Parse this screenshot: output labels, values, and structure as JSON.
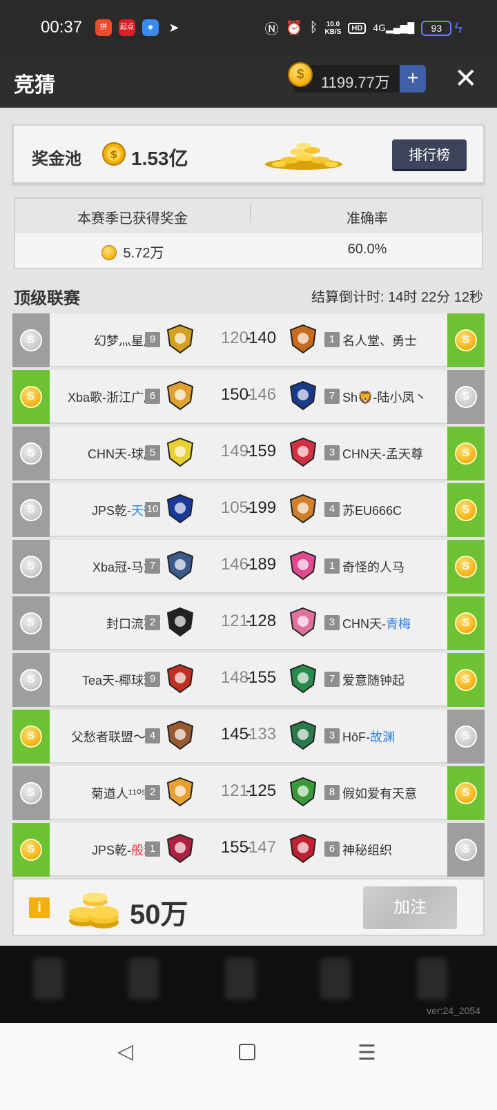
{
  "status_bar": {
    "time": "00:37",
    "apps": [
      "拼多多",
      "起点",
      "app",
      "plane"
    ],
    "net_speed": "10.0",
    "net_unit": "KB/S",
    "hd": "HD",
    "signal": "4G",
    "battery": "93"
  },
  "header": {
    "title": "竞猜",
    "balance": "1199.77万",
    "plus_label": "+",
    "close_label": "✕"
  },
  "pool": {
    "label": "奖金池",
    "amount": "1.53亿",
    "rank_button": "排行榜"
  },
  "stats": {
    "earned_label": "本赛季已获得奖金",
    "earned_value": "5.72万",
    "accuracy_label": "准确率",
    "accuracy_value": "60.0%"
  },
  "league": {
    "title": "顶级联赛",
    "countdown": "结算倒计时:  14时 22分 12秒"
  },
  "matches": [
    {
      "left_prefix": "幻梦灬星辰",
      "left_suffix": "",
      "left_color": "",
      "left_level": "9",
      "left_score": "120",
      "right_score": "140",
      "right_level": "1",
      "right_prefix": "名人堂、勇士",
      "right_suffix": "",
      "right_color": "",
      "winner": "right",
      "left_logo": "#d4a020",
      "right_logo": "#c96b1c"
    },
    {
      "left_prefix": "Xba歌-浙江广厦",
      "left_suffix": "",
      "left_color": "",
      "left_level": "6",
      "left_score": "150",
      "right_score": "146",
      "right_level": "7",
      "right_prefix": "Sh🦁-陆小凤丶",
      "right_suffix": "",
      "right_color": "",
      "winner": "left",
      "left_logo": "#e0a030",
      "right_logo": "#1a3a8a"
    },
    {
      "left_prefix": "CHN天-球魔",
      "left_suffix": "",
      "left_color": "",
      "left_level": "5",
      "left_score": "149",
      "right_score": "159",
      "right_level": "3",
      "right_prefix": "CHN天-孟天尊",
      "right_suffix": "",
      "right_color": "",
      "winner": "right",
      "left_logo": "#e8d030",
      "right_logo": "#d03040"
    },
    {
      "left_prefix": "JPS乾-",
      "left_suffix": "天微",
      "left_color": "blue",
      "left_level": "10",
      "left_score": "105",
      "right_score": "199",
      "right_level": "4",
      "right_prefix": "苏EU666C",
      "right_suffix": "",
      "right_color": "",
      "winner": "right",
      "left_logo": "#1a3a9a",
      "right_logo": "#d0802a"
    },
    {
      "left_prefix": "Xba冠-马龙",
      "left_suffix": "",
      "left_color": "",
      "left_level": "7",
      "left_score": "146",
      "right_score": "189",
      "right_level": "1",
      "right_prefix": "奇怪的人马",
      "right_suffix": "",
      "right_color": "",
      "winner": "right",
      "left_logo": "#3a5a8a",
      "right_logo": "#e04890"
    },
    {
      "left_prefix": "封口流花",
      "left_suffix": "",
      "left_color": "",
      "left_level": "2",
      "left_score": "121",
      "right_score": "128",
      "right_level": "3",
      "right_prefix": "CHN天-",
      "right_suffix": "青梅",
      "right_color": "blue",
      "winner": "right",
      "left_logo": "#222222",
      "right_logo": "#e070a0"
    },
    {
      "left_prefix": "Tea天-椰球球",
      "left_suffix": "",
      "left_color": "",
      "left_level": "9",
      "left_score": "148",
      "right_score": "155",
      "right_level": "7",
      "right_prefix": "爱意随钟起",
      "right_suffix": "",
      "right_color": "",
      "winner": "right",
      "left_logo": "#c03020",
      "right_logo": "#2a8a4a"
    },
    {
      "left_prefix": "父愁者联盟～...",
      "left_suffix": "",
      "left_color": "",
      "left_level": "4",
      "left_score": "145",
      "right_score": "133",
      "right_level": "3",
      "right_prefix": "HōF-",
      "right_suffix": "故渊",
      "right_color": "blue",
      "winner": "left",
      "left_logo": "#9a5a30",
      "right_logo": "#2a7a4a"
    },
    {
      "left_prefix": "菊道人¹¹⁰⁵²⁶",
      "left_suffix": "",
      "left_color": "",
      "left_level": "2",
      "left_score": "121",
      "right_score": "125",
      "right_level": "8",
      "right_prefix": "假如爱有天意",
      "right_suffix": "",
      "right_color": "",
      "winner": "right",
      "left_logo": "#e8a030",
      "right_logo": "#3a9a3a"
    },
    {
      "left_prefix": "JPS乾-",
      "left_suffix": "般若",
      "left_color": "red",
      "left_level": "1",
      "left_score": "155",
      "right_score": "147",
      "right_level": "6",
      "right_prefix": "神秘组织",
      "right_suffix": "",
      "right_color": "",
      "winner": "left",
      "left_logo": "#b02040",
      "right_logo": "#c02030"
    }
  ],
  "bet": {
    "info_label": "i",
    "amount": "50万",
    "add_button": "加注"
  },
  "footer": {
    "version": "ver:24_2054"
  },
  "system_nav": {
    "back": "◁",
    "menu": "☰"
  }
}
